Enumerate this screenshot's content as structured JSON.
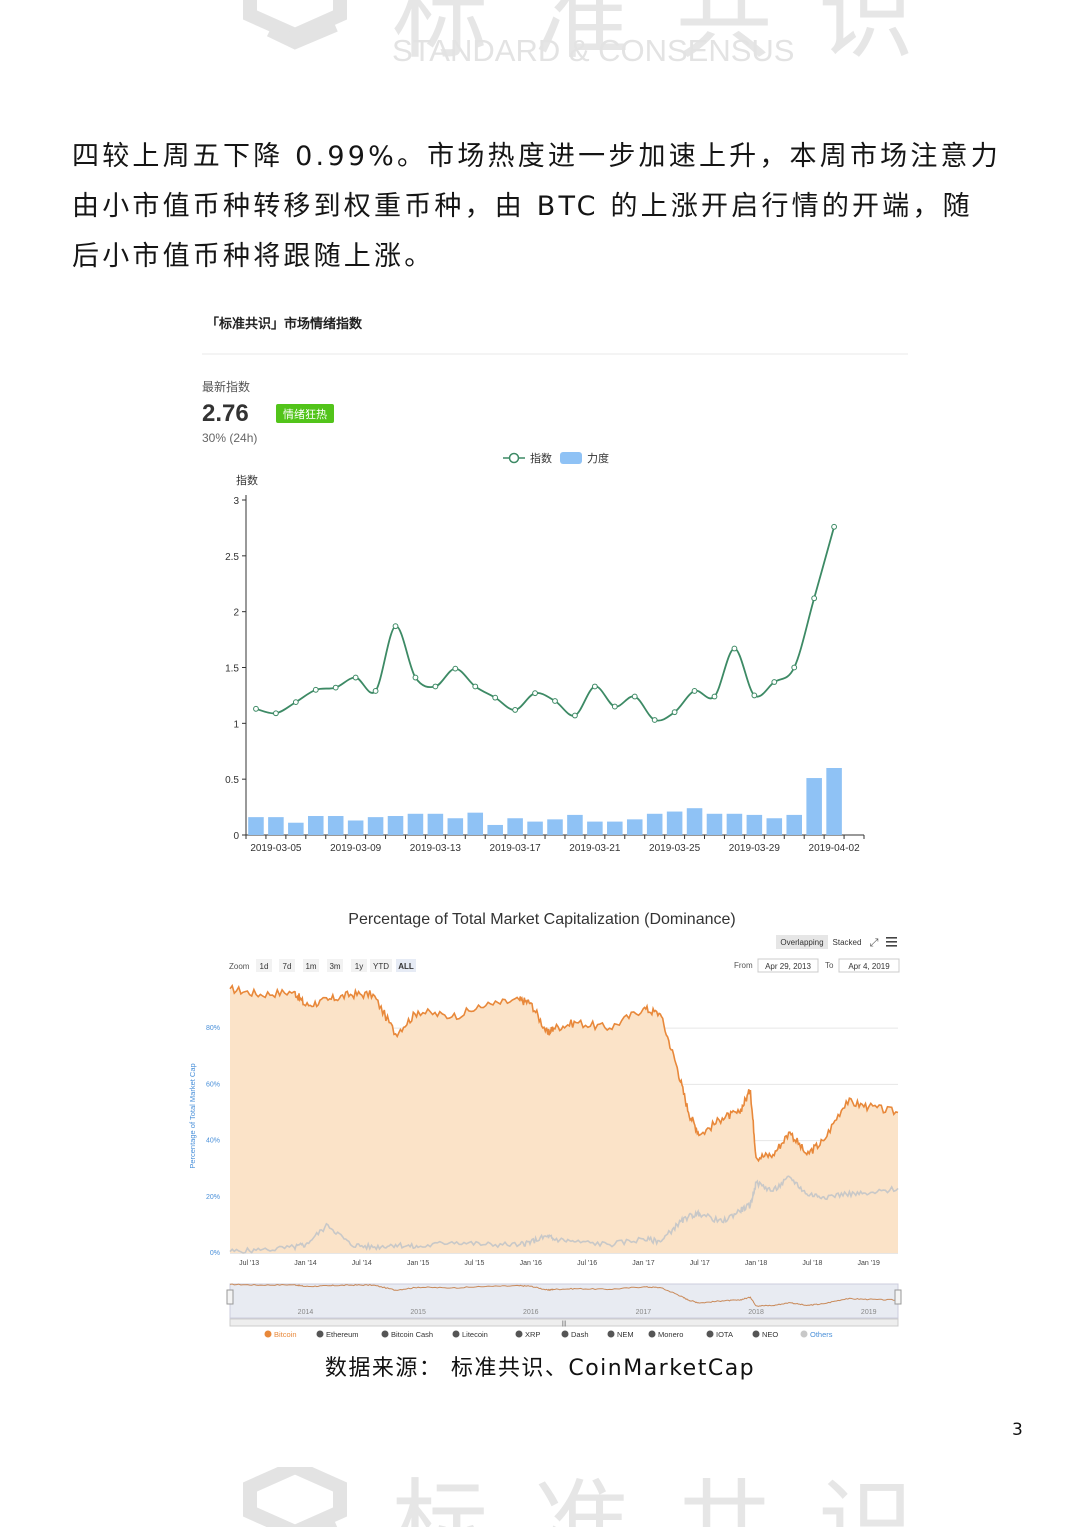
{
  "watermark": {
    "cn": "标准共识",
    "en": "STANDARD & CONSENSUS"
  },
  "paragraph": [
    "四较上周五下降 0.99%。市场热度进一步加速上升，本周市场注意力",
    "由小市值币种转移到权重币种，由 BTC 的上涨开启行情的开端，随",
    "后小市值币种将跟随上涨。"
  ],
  "sentiment": {
    "title": "「标准共识」市场情绪指数",
    "latest_label": "最新指数",
    "latest_value": "2.76",
    "badge": "情绪狂热",
    "badge_color": "#52c41a",
    "change": "30% (24h)",
    "legend": [
      "指数",
      "力度"
    ],
    "colors": {
      "line": "#3d8a65",
      "bar": "#8fc2f5"
    }
  },
  "dominance": {
    "title": "Percentage of Total Market Capitalization (Dominance)",
    "toggle": [
      "Overlapping",
      "Stacked"
    ],
    "zoom_label": "Zoom",
    "zoom_buttons": [
      "1d",
      "7d",
      "1m",
      "3m",
      "1y",
      "YTD",
      "ALL"
    ],
    "from_label": "From",
    "from_value": "Apr 29, 2013",
    "to_label": "To",
    "to_value": "Apr 4, 2019",
    "navigator_years": [
      "2014",
      "2015",
      "2016",
      "2017",
      "2018",
      "2019"
    ],
    "legend": [
      "Bitcoin",
      "Ethereum",
      "Bitcoin Cash",
      "Litecoin",
      "XRP",
      "Dash",
      "NEM",
      "Monero",
      "IOTA",
      "NEO",
      "Others"
    ],
    "colors": {
      "bitcoin": "#e8883a",
      "bitcoin_fill": "#fbe3c8",
      "others": "#c8c8c8",
      "legend_dark": "#555555",
      "axis_title": "#4a90d9"
    }
  },
  "caption": "数据来源：  标准共识、CoinMarketCap",
  "page_number": "3",
  "chart_data": [
    {
      "type": "line",
      "title": "「标准共识」市场情绪指数",
      "ylabel": "指数",
      "ylim": [
        0,
        3
      ],
      "yticks": [
        "3",
        "2.5",
        "2",
        "1.5",
        "1",
        "0.5",
        "0"
      ],
      "x_tick_labels": [
        "2019-03-05",
        "2019-03-09",
        "2019-03-13",
        "2019-03-17",
        "2019-03-21",
        "2019-03-25",
        "2019-03-29",
        "2019-04-02"
      ],
      "x": [
        "2019-03-04",
        "2019-03-05",
        "2019-03-06",
        "2019-03-07",
        "2019-03-08",
        "2019-03-09",
        "2019-03-10",
        "2019-03-11",
        "2019-03-12",
        "2019-03-13",
        "2019-03-14",
        "2019-03-15",
        "2019-03-16",
        "2019-03-17",
        "2019-03-18",
        "2019-03-19",
        "2019-03-20",
        "2019-03-21",
        "2019-03-22",
        "2019-03-23",
        "2019-03-24",
        "2019-03-25",
        "2019-03-26",
        "2019-03-27",
        "2019-03-28",
        "2019-03-29",
        "2019-03-30",
        "2019-03-31",
        "2019-04-01",
        "2019-04-02",
        "2019-04-03"
      ],
      "series": [
        {
          "name": "指数",
          "values": [
            1.13,
            1.09,
            1.19,
            1.3,
            1.32,
            1.41,
            1.29,
            1.87,
            1.41,
            1.33,
            1.49,
            1.33,
            1.23,
            1.12,
            1.27,
            1.2,
            1.07,
            1.33,
            1.15,
            1.24,
            1.03,
            1.1,
            1.29,
            1.24,
            1.67,
            1.25,
            1.37,
            1.5,
            2.12,
            2.76,
            null
          ]
        },
        {
          "name": "力度",
          "values": [
            0.16,
            0.16,
            0.11,
            0.17,
            0.17,
            0.13,
            0.16,
            0.17,
            0.19,
            0.19,
            0.15,
            0.2,
            0.09,
            0.15,
            0.12,
            0.14,
            0.18,
            0.12,
            0.12,
            0.14,
            0.19,
            0.21,
            0.24,
            0.19,
            0.19,
            0.18,
            0.15,
            0.18,
            0.51,
            0.6,
            null
          ]
        }
      ]
    },
    {
      "type": "area",
      "title": "Percentage of Total Market Capitalization (Dominance)",
      "ylabel": "Percentage of Total Market Cap",
      "ylim": [
        0,
        95
      ],
      "yticks": [
        "80%",
        "60%",
        "40%",
        "20%",
        "0%"
      ],
      "x_tick_labels": [
        "Jul '13",
        "Jan '14",
        "Jul '14",
        "Jan '15",
        "Jul '15",
        "Jan '16",
        "Jul '16",
        "Jan '17",
        "Jul '17",
        "Jan '18",
        "Jul '18",
        "Jan '19"
      ],
      "x": [
        2013.33,
        2013.6,
        2013.9,
        2014.0,
        2014.2,
        2014.4,
        2014.6,
        2014.8,
        2015.0,
        2015.3,
        2015.6,
        2015.9,
        2016.0,
        2016.15,
        2016.2,
        2016.4,
        2016.7,
        2017.0,
        2017.15,
        2017.3,
        2017.4,
        2017.5,
        2017.7,
        2017.85,
        2017.95,
        2018.0,
        2018.15,
        2018.3,
        2018.45,
        2018.6,
        2018.8,
        2019.0,
        2019.26
      ],
      "series": [
        {
          "name": "Bitcoin",
          "values": [
            94,
            92,
            93,
            88,
            90,
            92,
            92,
            78,
            86,
            84,
            88,
            90,
            89,
            78,
            80,
            82,
            80,
            87,
            85,
            66,
            50,
            42,
            48,
            50,
            58,
            34,
            35,
            43,
            35,
            40,
            54,
            52,
            50
          ]
        },
        {
          "name": "Others",
          "values": [
            0.5,
            1,
            2,
            3,
            10,
            3,
            2,
            3,
            2,
            4,
            3,
            3,
            4,
            6,
            5,
            4,
            3,
            5,
            4,
            10,
            13,
            14,
            11,
            15,
            17,
            25,
            22,
            27,
            21,
            20,
            21,
            21,
            23
          ]
        }
      ]
    }
  ]
}
